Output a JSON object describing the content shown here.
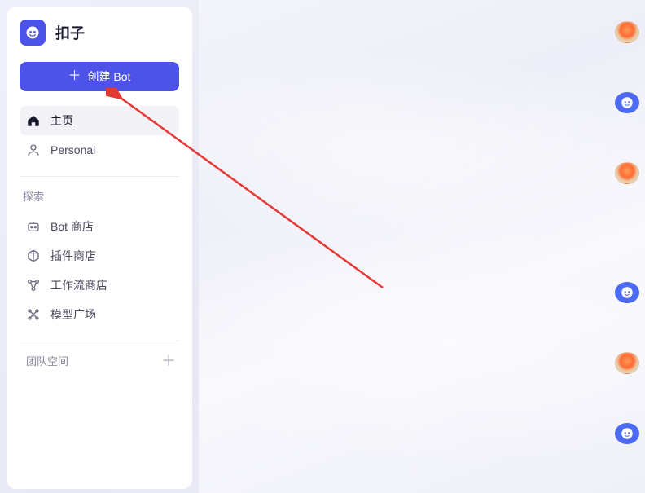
{
  "brand": {
    "name": "扣子"
  },
  "sidebar": {
    "create_label": "创建 Bot",
    "nav": {
      "home": "主页",
      "personal": "Personal"
    },
    "explore_label": "探索",
    "explore_items": {
      "bot_store": "Bot 商店",
      "plugin_store": "插件商店",
      "workflow_store": "工作流商店",
      "model_plaza": "模型广场"
    },
    "team_space_label": "团队空间"
  },
  "rail": {
    "items": [
      {
        "kind": "avatar",
        "name": "user-avatar-1"
      },
      {
        "kind": "bot",
        "name": "bot-avatar-1"
      },
      {
        "kind": "avatar",
        "name": "user-avatar-2"
      },
      {
        "kind": "bot",
        "name": "bot-avatar-2"
      },
      {
        "kind": "avatar",
        "name": "user-avatar-3"
      },
      {
        "kind": "bot",
        "name": "bot-avatar-3"
      }
    ]
  },
  "colors": {
    "primary": "#4d53e8",
    "rail_bot": "#4d6af2",
    "sidebar_bg": "#ffffff",
    "annotation_red": "#e53935"
  }
}
